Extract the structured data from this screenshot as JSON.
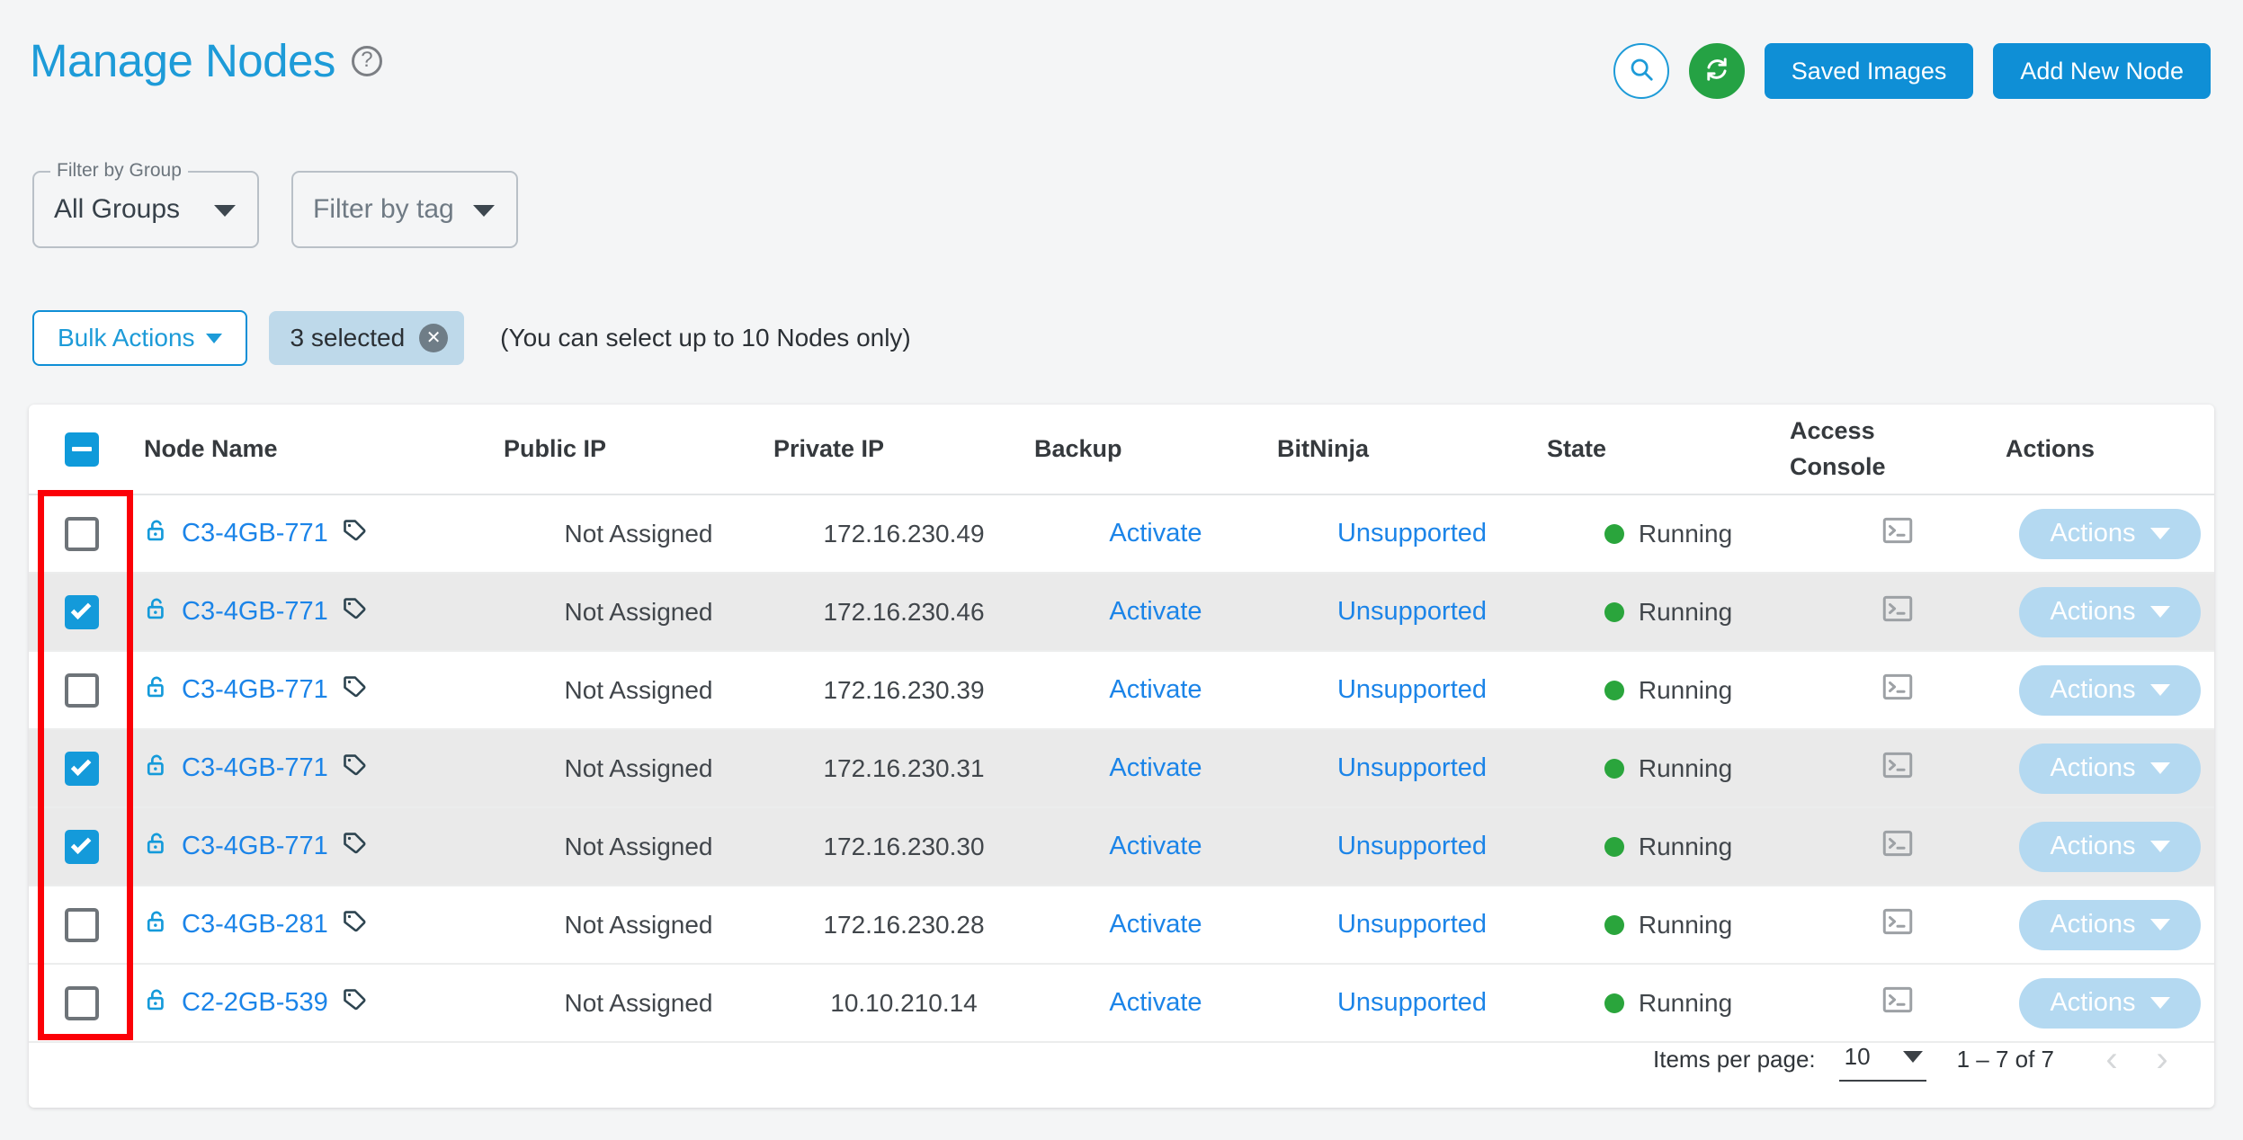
{
  "header": {
    "title": "Manage Nodes",
    "help_icon": "help-circle-icon",
    "search_icon": "search-icon",
    "refresh_icon": "refresh-icon",
    "saved_images_label": "Saved Images",
    "add_new_node_label": "Add New Node",
    "accent_blue": "#0f8fd6",
    "title_blue": "#1d9bd8",
    "refresh_green": "#25a244"
  },
  "filters": {
    "group": {
      "label": "Filter by Group",
      "value": "All Groups"
    },
    "tag": {
      "label": "",
      "placeholder": "Filter by tag",
      "value": "Filter by tag"
    }
  },
  "bulk": {
    "button_label": "Bulk Actions",
    "chip_label": "3 selected",
    "chip_clear_icon": "close-circle-icon",
    "hint": "(You can select up to 10 Nodes only)"
  },
  "table": {
    "select_all_state": "indeterminate",
    "columns": [
      {
        "key": "checkbox",
        "label": ""
      },
      {
        "key": "name",
        "label": "Node Name"
      },
      {
        "key": "public_ip",
        "label": "Public IP"
      },
      {
        "key": "private_ip",
        "label": "Private IP"
      },
      {
        "key": "backup",
        "label": "Backup"
      },
      {
        "key": "bitninja",
        "label": "BitNinja"
      },
      {
        "key": "state",
        "label": "State"
      },
      {
        "key": "access_console",
        "label_line1": "Access",
        "label_line2": "Console"
      },
      {
        "key": "actions",
        "label": "Actions"
      }
    ],
    "rows": [
      {
        "selected": false,
        "lock_icon": "unlock-icon",
        "name": "C3-4GB-771",
        "tag_icon": "tag-icon",
        "public_ip": "Not Assigned",
        "private_ip": "172.16.230.49",
        "backup": "Activate",
        "bitninja": "Unsupported",
        "state": "Running",
        "console_icon": "terminal-icon",
        "actions_label": "Actions"
      },
      {
        "selected": true,
        "lock_icon": "unlock-icon",
        "name": "C3-4GB-771",
        "tag_icon": "tag-icon",
        "public_ip": "Not Assigned",
        "private_ip": "172.16.230.46",
        "backup": "Activate",
        "bitninja": "Unsupported",
        "state": "Running",
        "console_icon": "terminal-icon",
        "actions_label": "Actions"
      },
      {
        "selected": false,
        "lock_icon": "unlock-icon",
        "name": "C3-4GB-771",
        "tag_icon": "tag-icon",
        "public_ip": "Not Assigned",
        "private_ip": "172.16.230.39",
        "backup": "Activate",
        "bitninja": "Unsupported",
        "state": "Running",
        "console_icon": "terminal-icon",
        "actions_label": "Actions"
      },
      {
        "selected": true,
        "lock_icon": "unlock-icon",
        "name": "C3-4GB-771",
        "tag_icon": "tag-icon",
        "public_ip": "Not Assigned",
        "private_ip": "172.16.230.31",
        "backup": "Activate",
        "bitninja": "Unsupported",
        "state": "Running",
        "console_icon": "terminal-icon",
        "actions_label": "Actions"
      },
      {
        "selected": true,
        "lock_icon": "unlock-icon",
        "name": "C3-4GB-771",
        "tag_icon": "tag-icon",
        "public_ip": "Not Assigned",
        "private_ip": "172.16.230.30",
        "backup": "Activate",
        "bitninja": "Unsupported",
        "state": "Running",
        "console_icon": "terminal-icon",
        "actions_label": "Actions"
      },
      {
        "selected": false,
        "lock_icon": "unlock-icon",
        "name": "C3-4GB-281",
        "tag_icon": "tag-icon",
        "public_ip": "Not Assigned",
        "private_ip": "172.16.230.28",
        "backup": "Activate",
        "bitninja": "Unsupported",
        "state": "Running",
        "console_icon": "terminal-icon",
        "actions_label": "Actions"
      },
      {
        "selected": false,
        "lock_icon": "unlock-icon",
        "name": "C2-2GB-539",
        "tag_icon": "tag-icon",
        "public_ip": "Not Assigned",
        "private_ip": "10.10.210.14",
        "backup": "Activate",
        "bitninja": "Unsupported",
        "state": "Running",
        "console_icon": "terminal-icon",
        "actions_label": "Actions"
      }
    ]
  },
  "paginator": {
    "items_per_page_label": "Items per page:",
    "items_per_page_value": "10",
    "range_label": "1 – 7 of 7",
    "prev_icon": "chevron-left-icon",
    "next_icon": "chevron-right-icon",
    "prev_label": "‹",
    "next_label": "›"
  },
  "annotation": {
    "color": "#fb0007",
    "target": "row-checkbox-column"
  }
}
